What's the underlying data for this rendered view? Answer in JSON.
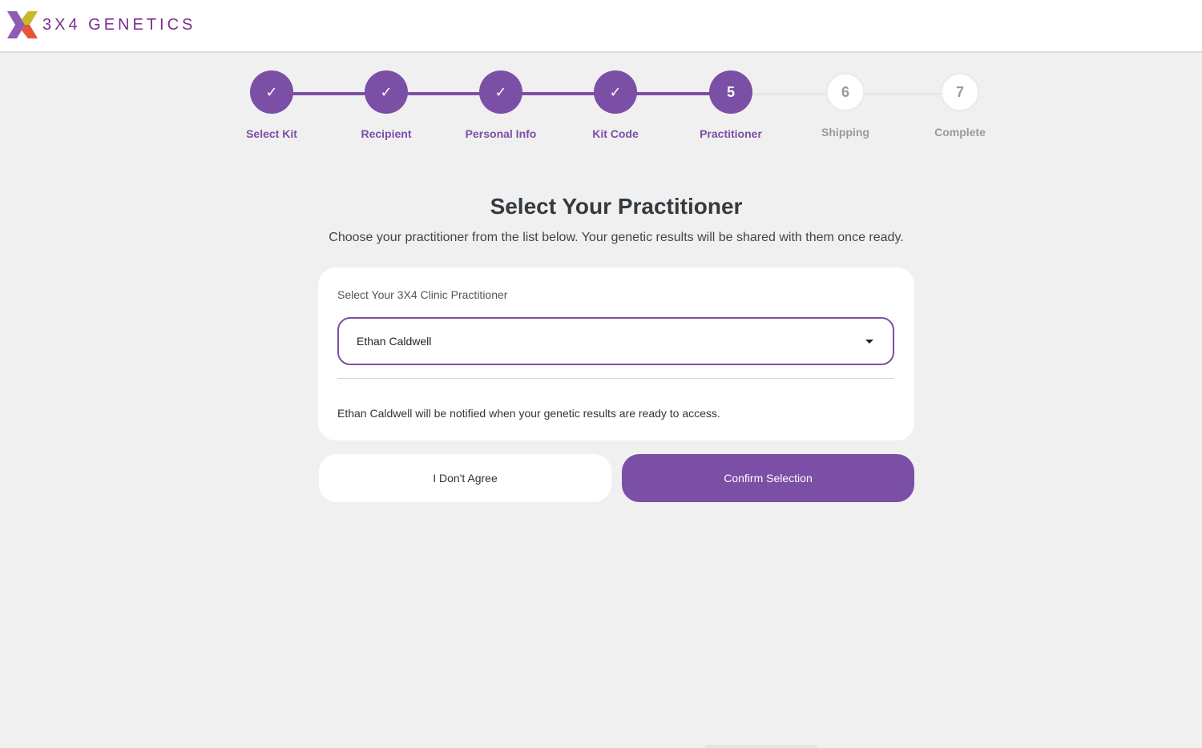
{
  "brand": {
    "name": "3X4 GENETICS",
    "colors": {
      "purple": "#7b4fa6",
      "logo_text": "#7b2d8e",
      "logo_orange": "#e8543a",
      "logo_yellow": "#c8b92a",
      "logo_violet": "#8e5bb5"
    }
  },
  "stepper": {
    "steps": [
      {
        "label": "Select Kit",
        "marker": "✓",
        "state": "complete"
      },
      {
        "label": "Recipient",
        "marker": "✓",
        "state": "complete"
      },
      {
        "label": "Personal Info",
        "marker": "✓",
        "state": "complete"
      },
      {
        "label": "Kit Code",
        "marker": "✓",
        "state": "complete"
      },
      {
        "label": "Practitioner",
        "marker": "5",
        "state": "current"
      },
      {
        "label": "Shipping",
        "marker": "6",
        "state": "upcoming"
      },
      {
        "label": "Complete",
        "marker": "7",
        "state": "upcoming"
      }
    ]
  },
  "main": {
    "title": "Select Your Practitioner",
    "subtitle": "Choose your practitioner from the list below. Your genetic results will be shared with them once ready.",
    "card": {
      "label": "Select Your 3X4 Clinic Practitioner",
      "selected_value": "Ethan Caldwell",
      "note": "Ethan Caldwell will be notified when your genetic results are ready to access."
    },
    "buttons": {
      "disagree": "I Don't Agree",
      "confirm": "Confirm Selection"
    }
  }
}
